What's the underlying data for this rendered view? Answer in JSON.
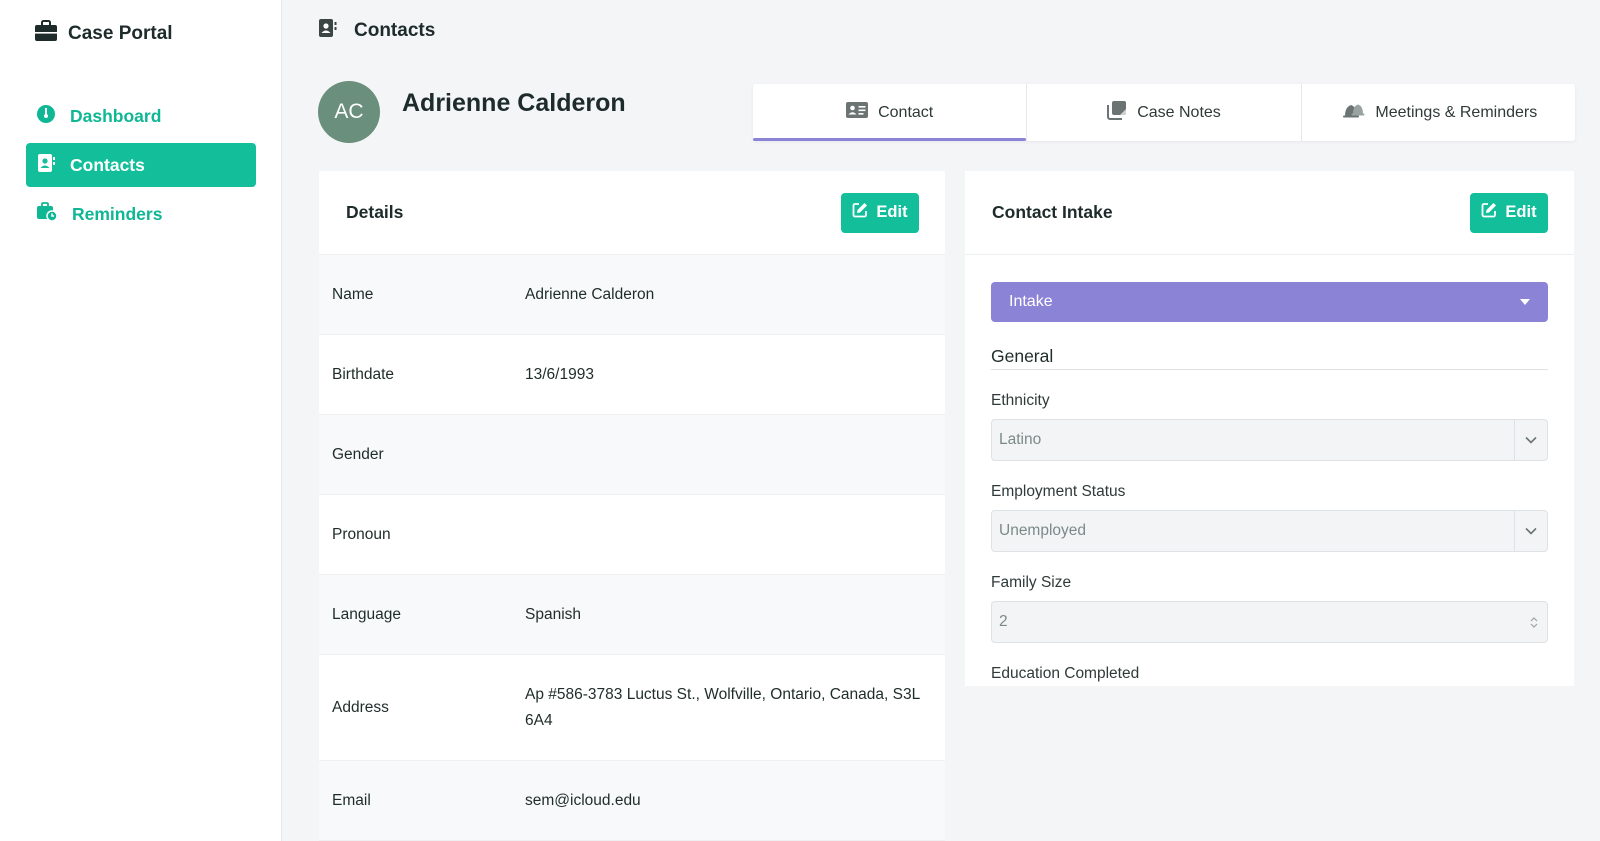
{
  "app": {
    "title": "Case Portal"
  },
  "sidebar": {
    "items": [
      {
        "label": "Dashboard",
        "icon": "dashboard-icon",
        "active": false
      },
      {
        "label": "Contacts",
        "icon": "contacts-icon",
        "active": true
      },
      {
        "label": "Reminders",
        "icon": "reminders-icon",
        "active": false
      }
    ]
  },
  "header": {
    "title": "Contacts"
  },
  "contact": {
    "initials": "AC",
    "name": "Adrienne Calderon"
  },
  "tabs": [
    {
      "label": "Contact",
      "icon": "contact-card-icon",
      "active": true
    },
    {
      "label": "Case Notes",
      "icon": "notes-icon",
      "active": false
    },
    {
      "label": "Meetings & Reminders",
      "icon": "bell-icon",
      "active": false
    }
  ],
  "details": {
    "title": "Details",
    "edit_label": "Edit",
    "rows": [
      {
        "label": "Name",
        "value": "Adrienne Calderon"
      },
      {
        "label": "Birthdate",
        "value": "13/6/1993"
      },
      {
        "label": "Gender",
        "value": ""
      },
      {
        "label": "Pronoun",
        "value": ""
      },
      {
        "label": "Language",
        "value": "Spanish"
      },
      {
        "label": "Address",
        "value": "Ap #586-3783 Luctus St., Wolfville, Ontario, Canada, S3L 6A4"
      },
      {
        "label": "Email",
        "value": "sem@icloud.edu"
      }
    ]
  },
  "intake": {
    "title": "Contact Intake",
    "edit_label": "Edit",
    "select_value": "Intake",
    "section": "General",
    "fields": {
      "ethnicity": {
        "label": "Ethnicity",
        "value": "Latino"
      },
      "employment": {
        "label": "Employment Status",
        "value": "Unemployed"
      },
      "family_size": {
        "label": "Family Size",
        "value": "2"
      },
      "education": {
        "label": "Education Completed"
      }
    }
  },
  "colors": {
    "accent": "#12bf9a",
    "purple": "#8b83d6",
    "avatar": "#6a8f7c"
  }
}
